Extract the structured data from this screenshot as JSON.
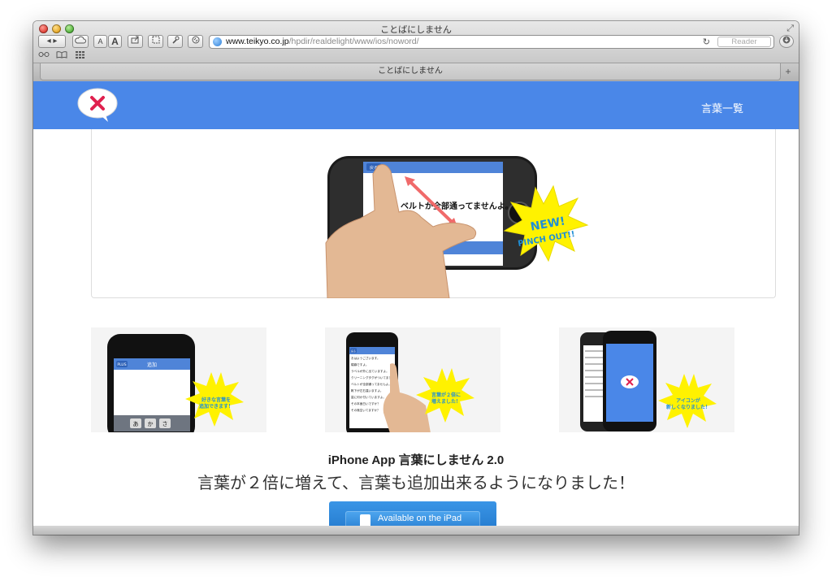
{
  "browser": {
    "window_title": "ことばにしません",
    "tab_title": "ことばにしません",
    "address": {
      "host": "www.teikyo.co.jp",
      "path": "/hpdir/realdelight/www/ios/noword/"
    },
    "reader_label": "Reader",
    "toolbar": {
      "font_small": "A",
      "font_large": "A"
    }
  },
  "site": {
    "nav_link": "言葉一覧",
    "logo_icon": "x-mark-speech-bubble",
    "accent_color": "#4a87e8"
  },
  "hero": {
    "phone_nav_button": "戻る",
    "sentence": "ベルトが全部通ってませんよ。",
    "burst_line1": "NEW!",
    "burst_line2": "PINCH OUT!!"
  },
  "thumbs": [
    {
      "nav_button": "PLUS",
      "nav_title": "追加",
      "keys": [
        "あ",
        "か",
        "さ"
      ],
      "burst_lines": [
        "好きな言葉を",
        "追加できます！"
      ]
    },
    {
      "nav_button": "戻る",
      "list": [
        "おはようございます。",
        "寝癖ですよ。",
        "ラベルが外に出ていますよ。",
        "クリーニングタグがついてますよ。",
        "ベルトが全部通ってませんよ。",
        "靴下が左右違いますよ。",
        "歯に何か付いていますよ。",
        "その本面白いですか？",
        "その席空いてますか？"
      ],
      "burst_lines": [
        "言葉が２倍に",
        "増えました！"
      ]
    },
    {
      "burst_lines": [
        "アイコンが",
        "新しくなりました！"
      ]
    }
  ],
  "app": {
    "title": "iPhone App 言葉にしません 2.0",
    "subtitle": "言葉が２倍に増えて、言葉も追加出来るようになりました！",
    "store_button": "Available on the iPad"
  }
}
